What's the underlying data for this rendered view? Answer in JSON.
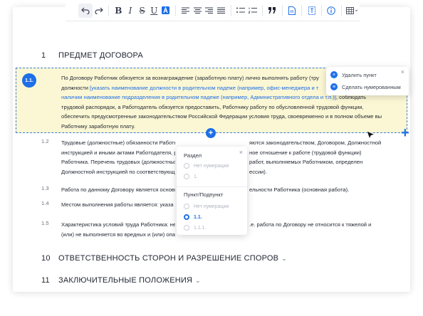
{
  "toolbar": {
    "buttons": [
      {
        "name": "undo-icon"
      },
      {
        "name": "redo-icon"
      },
      {
        "name": "bold-button",
        "label": "B"
      },
      {
        "name": "italic-button",
        "label": "I"
      },
      {
        "name": "strikethrough-button",
        "label": "S"
      },
      {
        "name": "underline-button",
        "label": "U"
      },
      {
        "name": "text-color-icon"
      },
      {
        "name": "align-left-icon"
      },
      {
        "name": "align-center-icon"
      },
      {
        "name": "align-right-icon"
      },
      {
        "name": "align-justify-icon"
      },
      {
        "name": "bullet-list-icon"
      },
      {
        "name": "numbered-list-icon"
      },
      {
        "name": "quote-icon"
      },
      {
        "name": "document-icon"
      },
      {
        "name": "variable-icon"
      },
      {
        "name": "info-icon"
      },
      {
        "name": "table-icon"
      }
    ]
  },
  "section1": {
    "num": "1",
    "title": "ПРЕДМЕТ ДОГОВОРА"
  },
  "item11": {
    "badge": "1.1.",
    "line1": "По Договору Работник обязуется за вознаграждение (заработную плату) лично выполнять работу (тру",
    "line2_pre": "должности ",
    "line2_link": "[указать наименование должности в родительном падеже (например, офис-менеджера и т",
    "line3_link": "наличии наименование подразделения в родительном падеже (например, Административного отдела и т.п.)]",
    "line3_post": ", соблюдать",
    "line4": "трудовой распорядок, а Работодатель обязуется предоставить, Работнику работу по обусловленной трудовой функции,",
    "line5": "обеспечить предусмотренные законодательством Российской Федерации условия труда, своевременно и в полном объеме выплачивать",
    "line6": "Работнику заработную плату."
  },
  "context_menu": {
    "delete_label": "Удалить пункт",
    "numbered_label": "Сделать нумерованным"
  },
  "item12": {
    "num": "1.2",
    "line1": "Трудовые (должностные) обязанности Работника определяются законодательством, Договором, Должностной",
    "line2": "инструкцией и иными актами Работодателя, регулирующими трудовое отношение к работе (трудовой функции)",
    "line3": "Работника. Перечень трудовых (должностных) обязанностей и работ, выполняемых Работником, определен",
    "line4": "Должностной инструкцией по соответствующей должности (профессии)."
  },
  "item13": {
    "num": "1.3",
    "text": "Работа по данному Договору является основным местом деятельности Работника (основная работа)."
  },
  "item14": {
    "num": "1.4",
    "text": "Местом выполнения работы является: указа"
  },
  "item15": {
    "num": "1.5",
    "line1": "Характеристика условий труда Работника: не                             т.е. работа по Договору не относится к тяжелой и",
    "line2": "(или) не выполняется во вредных и (или) опа"
  },
  "numbering_popup": {
    "section_label": "Раздел",
    "section_options": [
      {
        "label": "Нет нумерации",
        "checked": false
      },
      {
        "label": "1.",
        "checked": false
      }
    ],
    "subsection_label": "Пункт/Подпункт",
    "subsection_options": [
      {
        "label": "Нет нумерации",
        "checked": false
      },
      {
        "label": "1.1.",
        "checked": true
      },
      {
        "label": "1.1.1.",
        "checked": false
      }
    ]
  },
  "section10": {
    "num": "10",
    "title": "ОТВЕТСТВЕННОСТЬ СТОРОН И РАЗРЕШЕНИЕ СПОРОВ"
  },
  "section11": {
    "num": "11",
    "title": "ЗАКЛЮЧИТЕЛЬНЫЕ ПОЛОЖЕНИЯ"
  },
  "accent_color": "#1e6fe8",
  "highlight_color": "#fbf7d4"
}
